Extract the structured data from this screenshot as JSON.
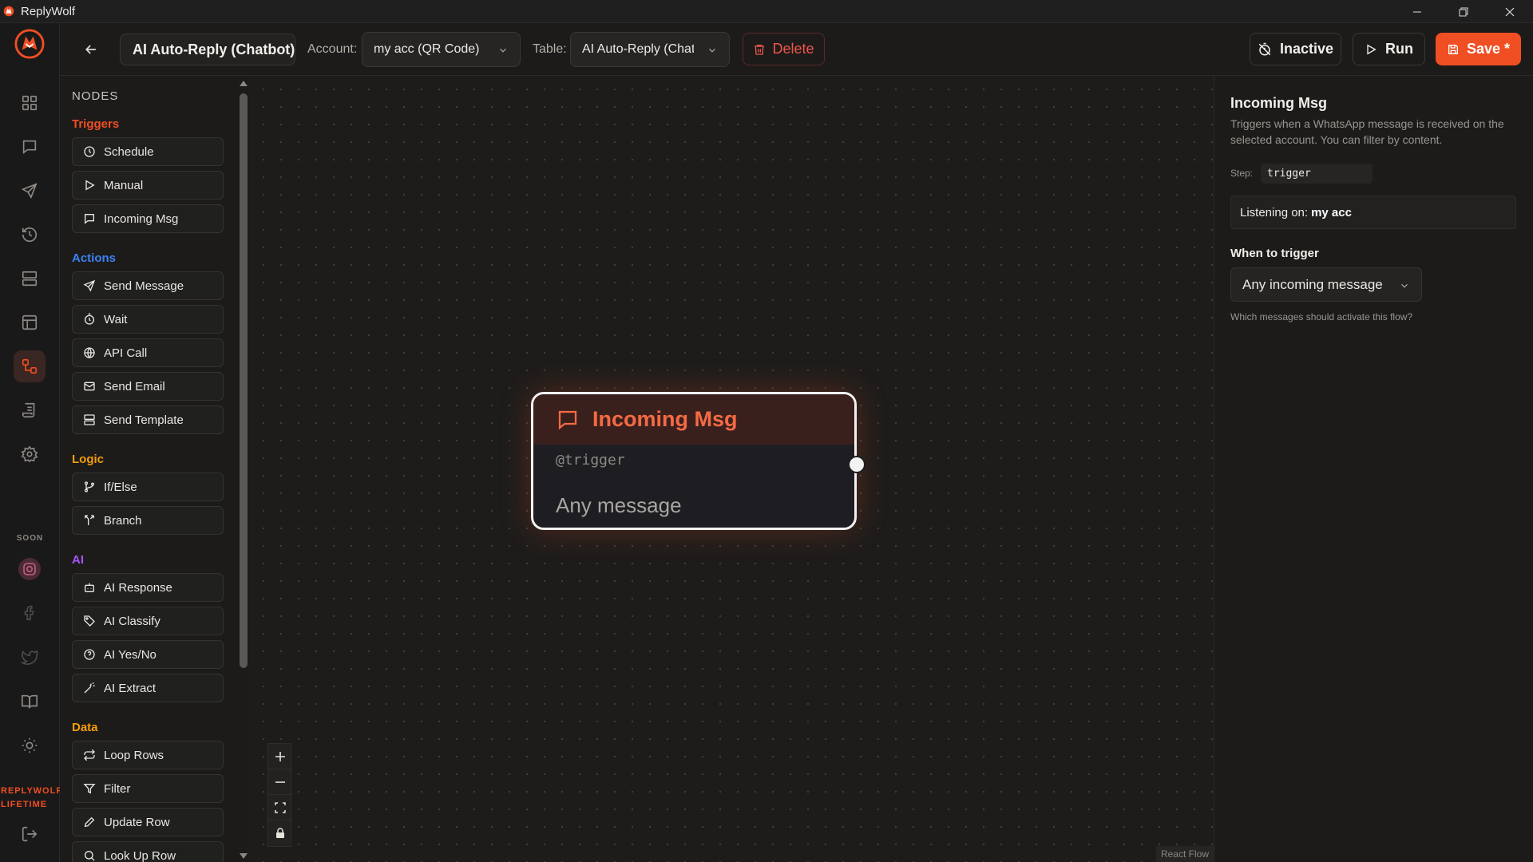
{
  "window": {
    "title": "ReplyWolf"
  },
  "rail": {
    "soon_label": "SOON",
    "plan_label_1": "REPLYWOLF",
    "plan_label_2": "LIFETIME"
  },
  "toolbar": {
    "flow_name": "AI Auto-Reply (Chatbot)",
    "account_label": "Account:",
    "account_value": "my acc (QR Code)",
    "table_label": "Table:",
    "table_value": "AI Auto-Reply (Chatbot)",
    "delete_label": "Delete",
    "inactive_label": "Inactive",
    "run_label": "Run",
    "save_label": "Save *"
  },
  "palette": {
    "heading": "NODES",
    "categories": [
      {
        "name": "Triggers",
        "color": "#f04e23",
        "items": [
          "Schedule",
          "Manual",
          "Incoming Msg"
        ]
      },
      {
        "name": "Actions",
        "color": "#3b82f6",
        "items": [
          "Send Message",
          "Wait",
          "API Call",
          "Send Email",
          "Send Template"
        ]
      },
      {
        "name": "Logic",
        "color": "#f59e0b",
        "items": [
          "If/Else",
          "Branch"
        ]
      },
      {
        "name": "AI",
        "color": "#a855f7",
        "items": [
          "AI Response",
          "AI Classify",
          "AI Yes/No",
          "AI Extract"
        ]
      },
      {
        "name": "Data",
        "color": "#f59e0b",
        "items": [
          "Loop Rows",
          "Filter",
          "Update Row",
          "Look Up Row"
        ]
      }
    ]
  },
  "canvas": {
    "node": {
      "title": "Incoming Msg",
      "step": "@trigger",
      "description": "Any message"
    },
    "attribution": "React Flow"
  },
  "inspector": {
    "title": "Incoming Msg",
    "description": "Triggers when a WhatsApp message is received on the selected account. You can filter by content.",
    "step_label": "Step:",
    "step_value": "trigger",
    "listening_prefix": "Listening on:",
    "listening_account": "my acc",
    "when_label": "When to trigger",
    "when_value": "Any incoming message",
    "when_help": "Which messages should activate this flow?"
  },
  "colors": {
    "accent": "#f04e23",
    "danger": "#f0564a",
    "background": "#1c1b1a"
  }
}
